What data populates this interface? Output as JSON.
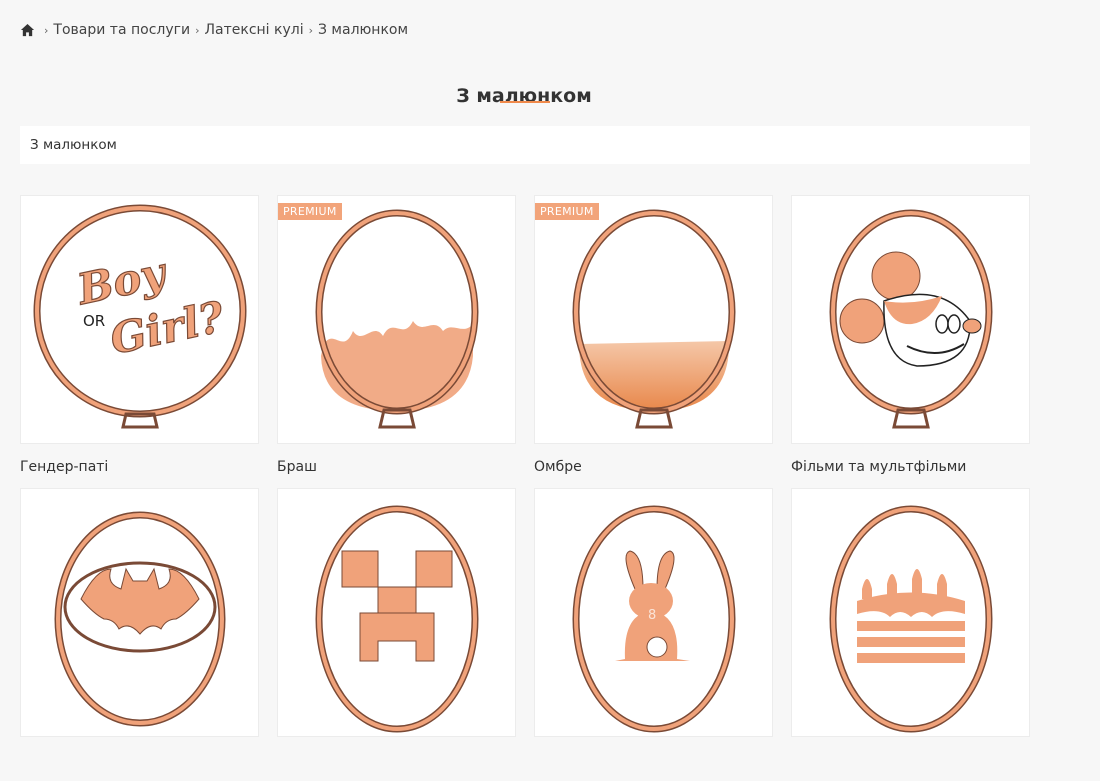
{
  "breadcrumb": {
    "items": [
      "Товари та послуги",
      "Латексні кулі",
      "З малюнком"
    ]
  },
  "page": {
    "title": "З малюнком",
    "filter_text": "З малюнком"
  },
  "colors": {
    "accent": "#f08a4b",
    "balloon_fill": "#f0a27a",
    "balloon_outline": "#7a4a36",
    "badge": "#f2a47a"
  },
  "products": [
    {
      "name": "Гендер-паті",
      "badge": null,
      "art": "gender-party",
      "text_boy": "Boy",
      "text_or": "OR",
      "text_girl": "Girl?"
    },
    {
      "name": "Браш",
      "badge": "PREMIUM",
      "art": "brush"
    },
    {
      "name": "Омбре",
      "badge": "PREMIUM",
      "art": "ombre"
    },
    {
      "name": "Фільми та мультфільми",
      "badge": null,
      "art": "mickey"
    },
    {
      "name": "",
      "badge": null,
      "art": "batman"
    },
    {
      "name": "",
      "badge": null,
      "art": "creeper"
    },
    {
      "name": "",
      "badge": null,
      "art": "bunny",
      "number": "8"
    },
    {
      "name": "",
      "badge": null,
      "art": "cake"
    }
  ]
}
